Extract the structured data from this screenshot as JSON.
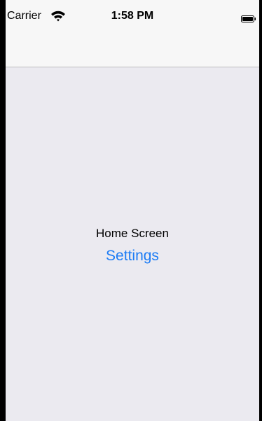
{
  "status_bar": {
    "carrier": "Carrier",
    "time": "1:58 PM",
    "wifi_icon": "wifi-icon",
    "battery_icon": "battery-icon"
  },
  "main": {
    "title": "Home Screen",
    "settings_label": "Settings"
  },
  "colors": {
    "accent": "#1C7CF5",
    "background": "#EBEAF0",
    "bar_background": "#F7F7F7"
  }
}
